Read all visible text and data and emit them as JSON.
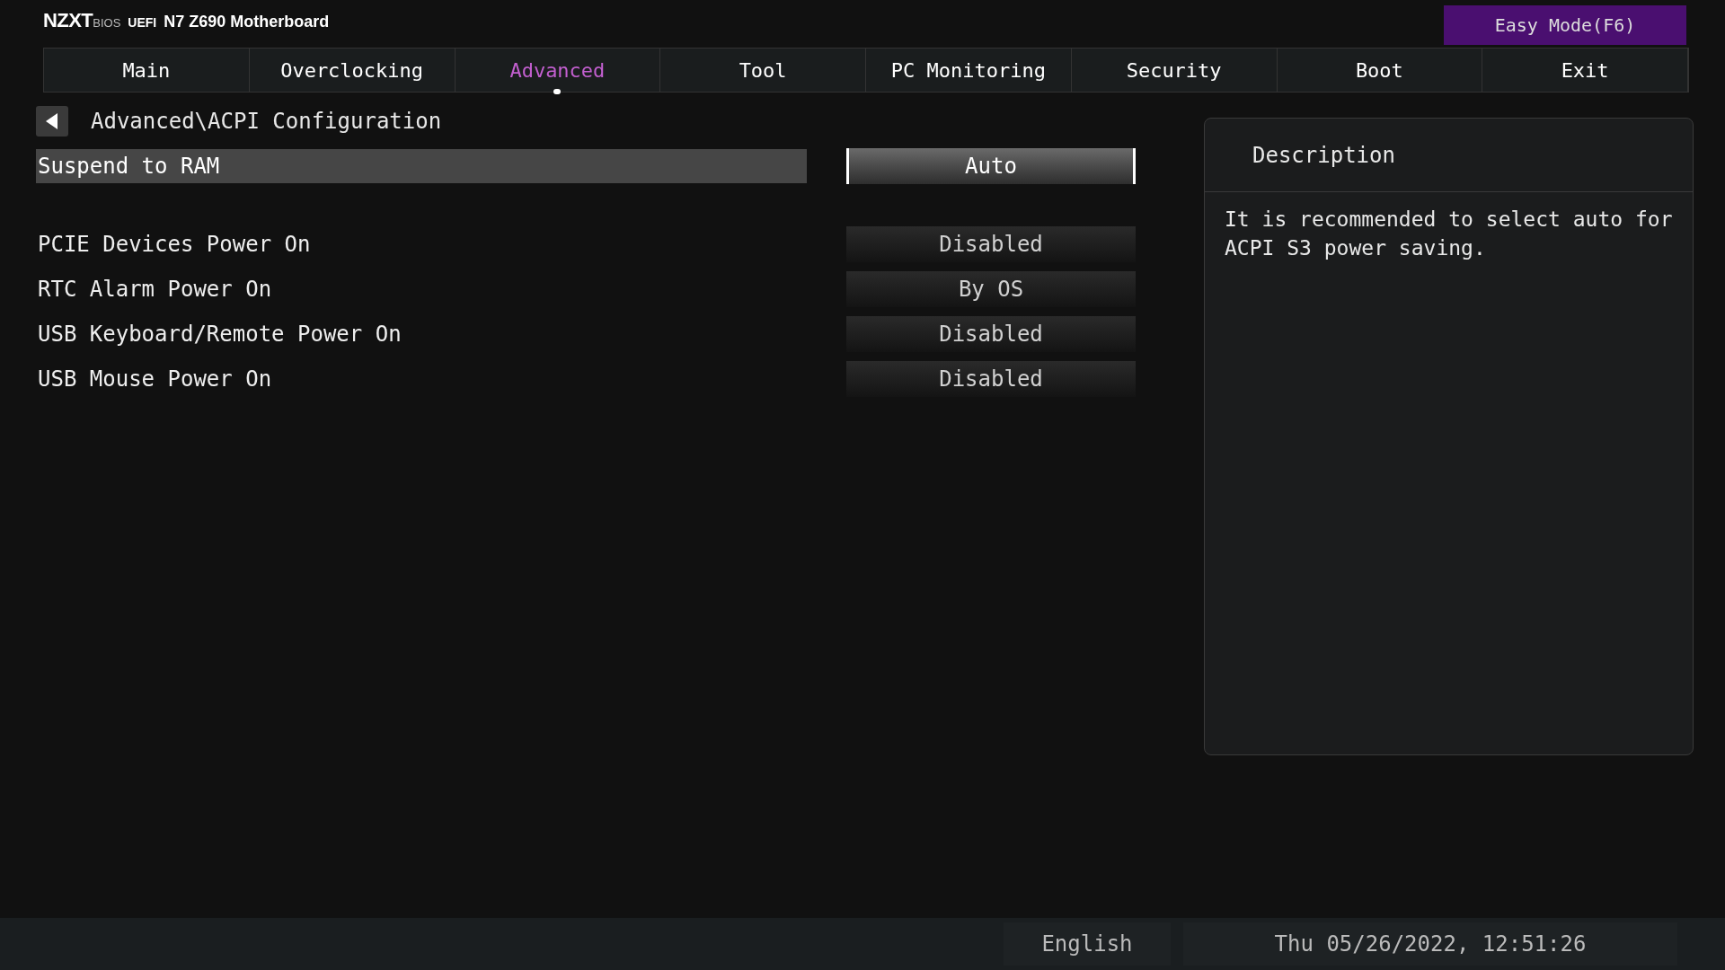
{
  "header": {
    "brand": "NZXT",
    "bios": "BIOS",
    "uefi": "UEFI",
    "board": "N7 Z690 Motherboard",
    "easy_mode": "Easy Mode(F6)"
  },
  "tabs": [
    {
      "label": "Main",
      "selected": false
    },
    {
      "label": "Overclocking",
      "selected": false
    },
    {
      "label": "Advanced",
      "selected": true
    },
    {
      "label": "Tool",
      "selected": false
    },
    {
      "label": "PC Monitoring",
      "selected": false
    },
    {
      "label": "Security",
      "selected": false
    },
    {
      "label": "Boot",
      "selected": false
    },
    {
      "label": "Exit",
      "selected": false
    }
  ],
  "breadcrumb": "Advanced\\ACPI Configuration",
  "settings": [
    {
      "name": "Suspend to RAM",
      "value": "Auto",
      "selected": true
    },
    {
      "name": "PCIE Devices Power On",
      "value": "Disabled",
      "selected": false
    },
    {
      "name": "RTC Alarm Power On",
      "value": "By OS",
      "selected": false
    },
    {
      "name": "USB Keyboard/Remote Power On",
      "value": "Disabled",
      "selected": false
    },
    {
      "name": "USB Mouse Power On",
      "value": "Disabled",
      "selected": false
    }
  ],
  "description": {
    "title": "Description",
    "text": "It is recommended to select auto for ACPI S3 power saving."
  },
  "status_bar": {
    "language": "English",
    "datetime": "Thu 05/26/2022, 12:51:26"
  }
}
